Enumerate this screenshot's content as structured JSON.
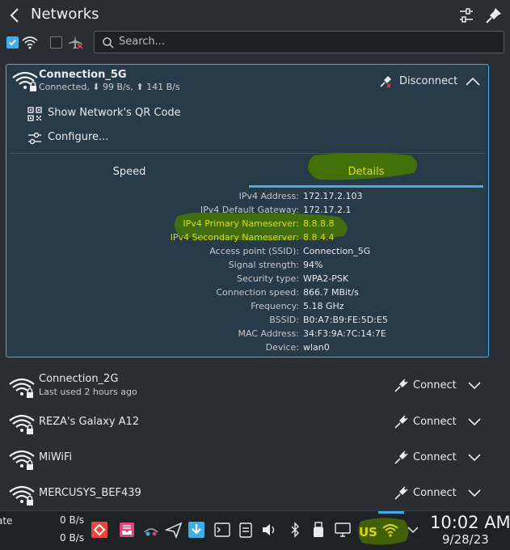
{
  "header": {
    "title": "Networks"
  },
  "search": {
    "placeholder": "Search..."
  },
  "active": {
    "name": "Connection_5G",
    "status": "Connected, ⬇ 99 B/s, ⬆ 141 B/s",
    "disconnect_label": "Disconnect",
    "actions": {
      "qr": "Show Network's QR Code",
      "configure": "Configure..."
    },
    "tabs": {
      "speed": "Speed",
      "details": "Details"
    },
    "details": [
      {
        "k": "IPv4 Address:",
        "v": "172.17.2.103"
      },
      {
        "k": "IPv4 Default Gateway:",
        "v": "172.17.2.1"
      },
      {
        "k": "IPv4 Primary Nameserver:",
        "v": "8.8.8.8"
      },
      {
        "k": "IPv4 Secondary Nameserver:",
        "v": "8.8.4.4"
      },
      {
        "k": "Access point (SSID):",
        "v": "Connection_5G"
      },
      {
        "k": "Signal strength:",
        "v": "94%"
      },
      {
        "k": "Security type:",
        "v": "WPA2-PSK"
      },
      {
        "k": "Connection speed:",
        "v": "866.7 MBit/s"
      },
      {
        "k": "Frequency:",
        "v": "5.18 GHz"
      },
      {
        "k": "BSSID:",
        "v": "B0:A7:B9:FE:5D:E5"
      },
      {
        "k": "MAC Address:",
        "v": "34:F3:9A:7C:14:7E"
      },
      {
        "k": "Device:",
        "v": "wlan0"
      }
    ]
  },
  "networks": [
    {
      "name": "Connection_2G",
      "sub": "Last used 2 hours ago",
      "action": "Connect"
    },
    {
      "name": "REZA's Galaxy A12",
      "sub": "",
      "action": "Connect"
    },
    {
      "name": "MiWiFi",
      "sub": "",
      "action": "Connect"
    },
    {
      "name": "MERCUSYS_BEF439",
      "sub": "",
      "action": "Connect"
    }
  ],
  "taskbar": {
    "partial_label": "ate",
    "down_rate": "0 B/s",
    "up_rate": "0 B/s",
    "keyboard_layout": "US",
    "time": "10:02 AM",
    "date": "9/28/23"
  },
  "colors": {
    "accent": "#3daee9",
    "highlight": "#d8e000",
    "annotation": "#4a7a00"
  }
}
